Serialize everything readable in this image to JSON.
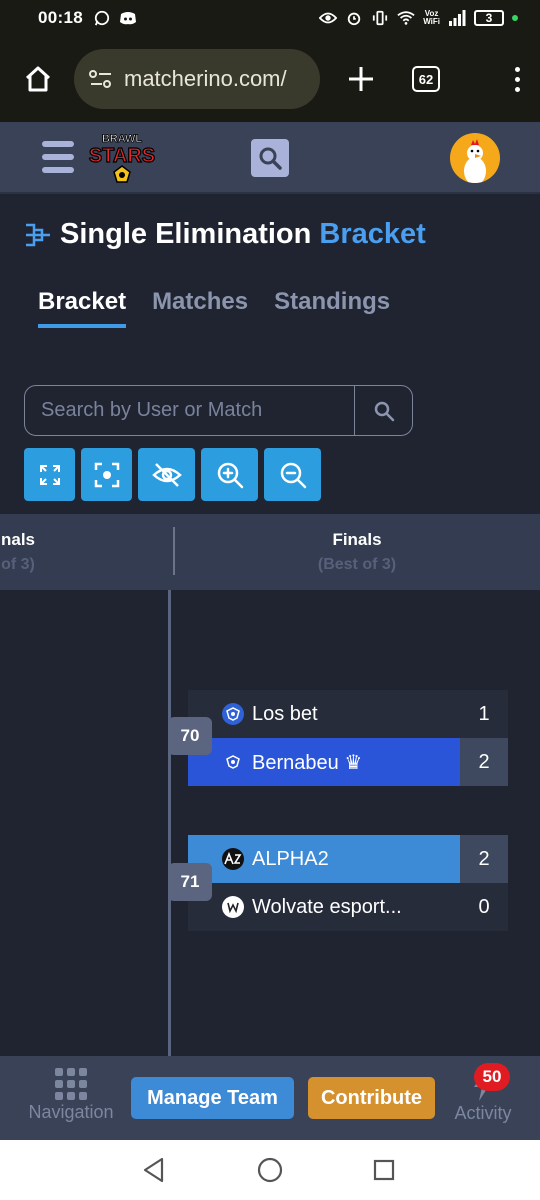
{
  "status_bar": {
    "time": "00:18",
    "wifi_label_1": "Voz",
    "wifi_label_2": "WiFi",
    "battery": "3"
  },
  "browser": {
    "url": "matcherino.com/",
    "tab_count": "62"
  },
  "site": {
    "logo_text_top": "BRAWL",
    "logo_text_main": "STARS"
  },
  "page": {
    "title_main": "Single Elimination",
    "title_accent": "Bracket",
    "tabs": [
      {
        "label": "Bracket",
        "active": true
      },
      {
        "label": "Matches",
        "active": false
      },
      {
        "label": "Standings",
        "active": false
      }
    ],
    "search_placeholder": "Search by User or Match"
  },
  "toolbar": [
    "fullscreen-icon",
    "focus-icon",
    "hide-icon",
    "zoom-in-icon",
    "zoom-out-icon"
  ],
  "rounds": [
    {
      "title": "nals",
      "subtitle": "of 3)"
    },
    {
      "title": "Finals",
      "subtitle": "(Best of 3)"
    }
  ],
  "matches": [
    {
      "number": "70",
      "teams": [
        {
          "name": "Los bet",
          "score": "1",
          "winner": false
        },
        {
          "name": "Bernabeu",
          "score": "2",
          "winner": true,
          "crown": "♛"
        }
      ]
    },
    {
      "number": "71",
      "teams": [
        {
          "name": "ALPHA2",
          "score": "2",
          "winner": true
        },
        {
          "name": "Wolvate esport...",
          "score": "0",
          "winner": false
        }
      ]
    }
  ],
  "bottom_nav": {
    "navigation": "Navigation",
    "manage_team": "Manage Team",
    "contribute": "Contribute",
    "activity": "Activity",
    "activity_badge": "50"
  },
  "colors": {
    "accent": "#4a9ff0",
    "win_blue": "#2a55d8",
    "win_light_blue": "#3d8ad6",
    "contribute": "#d4912d",
    "badge": "#e11b22"
  }
}
